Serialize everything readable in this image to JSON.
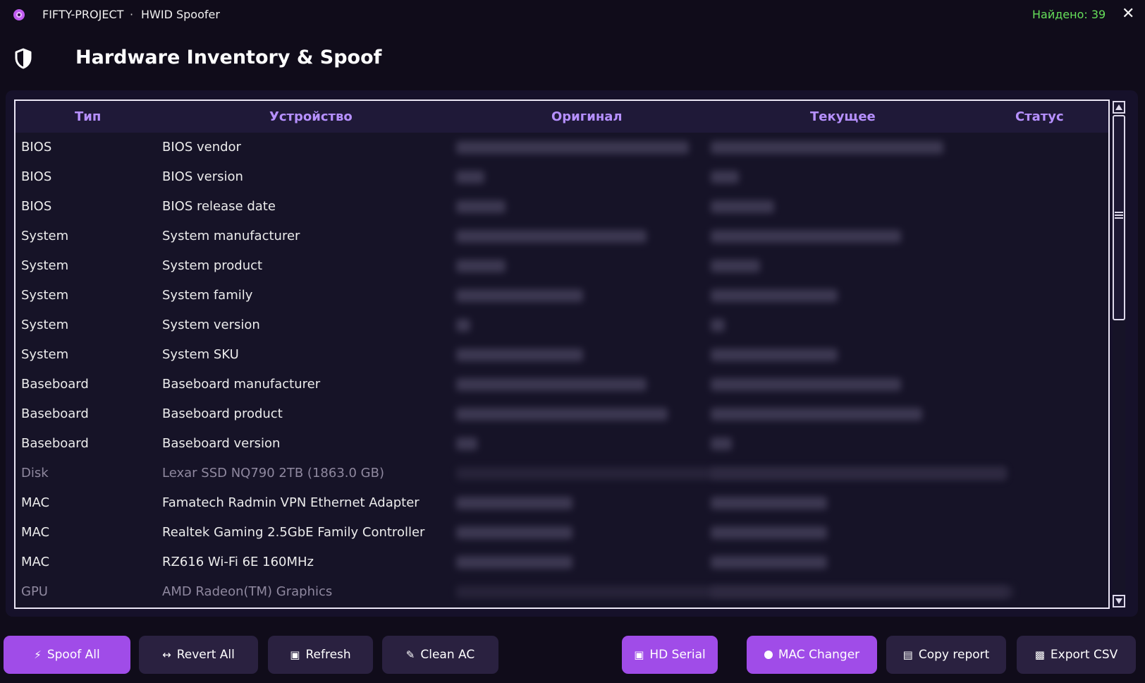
{
  "titlebar": {
    "app_name": "FIFTY-PROJECT",
    "separator": "·",
    "subtitle": "HWID Spoofer",
    "found": "Найдено: 39",
    "close": "✕"
  },
  "header": {
    "title": "Hardware Inventory & Spoof"
  },
  "table": {
    "columns": [
      "Тип",
      "Устройство",
      "Оригинал",
      "Текущее",
      "Статус"
    ],
    "rows": [
      {
        "type": "BIOS",
        "device": "BIOS vendor",
        "dim": false
      },
      {
        "type": "BIOS",
        "device": "BIOS version",
        "dim": false
      },
      {
        "type": "BIOS",
        "device": "BIOS release date",
        "dim": false
      },
      {
        "type": "System",
        "device": "System manufacturer",
        "dim": false
      },
      {
        "type": "System",
        "device": "System product",
        "dim": false
      },
      {
        "type": "System",
        "device": "System family",
        "dim": false
      },
      {
        "type": "System",
        "device": "System version",
        "dim": false
      },
      {
        "type": "System",
        "device": "System SKU",
        "dim": false
      },
      {
        "type": "Baseboard",
        "device": "Baseboard manufacturer",
        "dim": false
      },
      {
        "type": "Baseboard",
        "device": "Baseboard product",
        "dim": false
      },
      {
        "type": "Baseboard",
        "device": "Baseboard version",
        "dim": false
      },
      {
        "type": "Disk",
        "device": "Lexar SSD NQ790 2TB (1863.0 GB)",
        "dim": true
      },
      {
        "type": "MAC",
        "device": "Famatech Radmin VPN Ethernet Adapter",
        "dim": false
      },
      {
        "type": "MAC",
        "device": "Realtek Gaming 2.5GbE Family Controller",
        "dim": false
      },
      {
        "type": "MAC",
        "device": "RZ616 Wi-Fi 6E 160MHz",
        "dim": false
      },
      {
        "type": "GPU",
        "device": "AMD Radeon(TM) Graphics",
        "dim": true
      }
    ]
  },
  "buttons": {
    "spoof_all": "Spoof All",
    "revert_all": "Revert All",
    "refresh": "Refresh",
    "clean_ac": "Clean AC",
    "hd_serial": "HD Serial",
    "mac_changer": "MAC Changer",
    "copy_report": "Copy report",
    "export_csv": "Export CSV"
  },
  "colors": {
    "background": "#100c1a",
    "accent": "#a04ce8",
    "header_text": "#b690ff",
    "found_text": "#66e05a",
    "secondary_button": "#2a2140"
  }
}
